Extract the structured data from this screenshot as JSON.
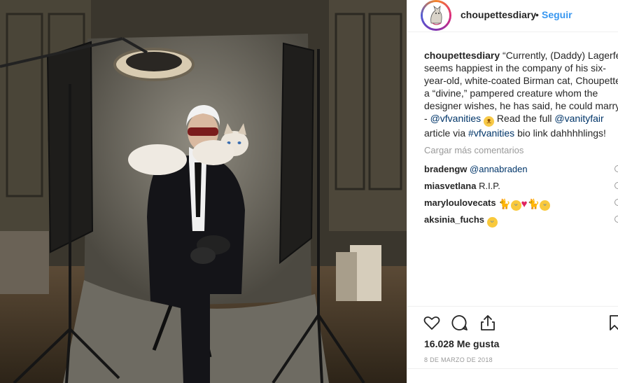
{
  "photo": {
    "alt": "Man in dark suit with white cat on shoulder in photo studio"
  },
  "post": {
    "username": "choupettesdiary",
    "separator": "•",
    "follow_label": "Seguir",
    "caption_username": "choupettesdiary",
    "caption_lines": [
      "“Currently, (Daddy) Lagerfeld",
      "seems happiest in the company of his six-",
      "year-old, white-coated Birman cat, Choupette,",
      "a “divine,” pampered creature whom the",
      "designer wishes, he has said, he could marry.”"
    ],
    "caption_line6_prefix": "- ",
    "mention_1": "@vfvanities",
    "caption_line6_mid": " Read the full ",
    "mention_2": "@vanityfair",
    "caption_line7_prefix": "article via ",
    "hashtag": "#vfvanities",
    "caption_line7_suffix": " bio link dahhhhlings!",
    "load_more_label": "Cargar más comentarios"
  },
  "comments": [
    {
      "username": "bradengw",
      "text": "@annabraden",
      "is_mention": true
    },
    {
      "username": "miasvetlana",
      "text": "R.I.P.",
      "is_mention": false
    },
    {
      "username": "maryloulovecats",
      "text": "",
      "emojis": [
        "cat-emoji",
        "crying-emoji",
        "heart-emoji",
        "cat-emoji",
        "crying-emoji"
      ]
    },
    {
      "username": "aksinia_fuchs",
      "text": "",
      "emojis": [
        "sobbing-emoji"
      ]
    }
  ],
  "actions": {
    "like_icon": "heart-outline-icon",
    "comment_icon": "comment-bubble-icon",
    "share_icon": "share-icon",
    "save_icon": "bookmark-icon"
  },
  "likes_label": "16.028 Me gusta",
  "date_label": "8 de marzo de 2018",
  "colors": {
    "link": "#003569",
    "follow": "#3897f0",
    "muted": "#999999",
    "text": "#262626",
    "border": "#efefef"
  }
}
